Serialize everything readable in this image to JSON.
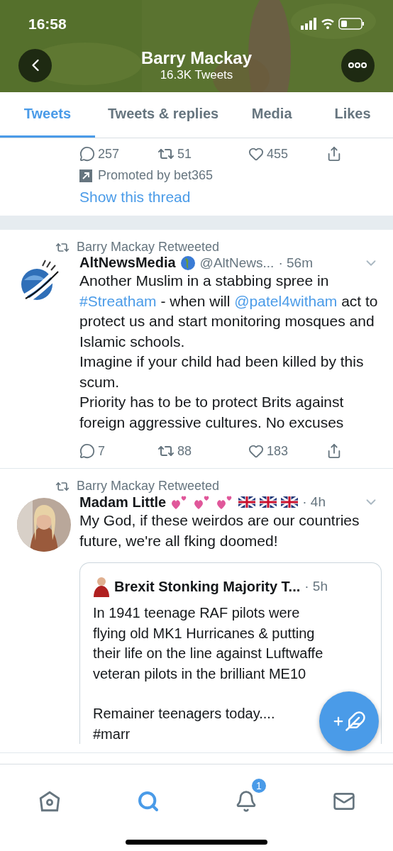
{
  "status_bar": {
    "time": "16:58"
  },
  "profile_header": {
    "name": "Barry Mackay",
    "tweet_count": "16.3K Tweets"
  },
  "tabs": [
    {
      "label": "Tweets",
      "selected": true
    },
    {
      "label": "Tweets & replies",
      "selected": false
    },
    {
      "label": "Media",
      "selected": false
    },
    {
      "label": "Likes",
      "selected": false
    }
  ],
  "partial_tweet": {
    "stats": {
      "replies": "257",
      "retweets": "51",
      "likes": "455"
    },
    "promoted": "Promoted by bet365",
    "thread_link": "Show this thread"
  },
  "tweets": [
    {
      "kind": "logo",
      "retweeted_by": "Barry Mackay Retweeted",
      "name": "AltNewsMedia",
      "name_icons": [
        {
          "kind": "globe"
        }
      ],
      "handle": "@AltNews...",
      "time": "· 56m",
      "paragraphs": [
        [
          {
            "kind": "text",
            "text": "Another Muslim in a stabbing spree in"
          },
          {
            "kind": "link",
            "text": "#Streatham"
          },
          {
            "kind": "text",
            "text": "- when will"
          },
          {
            "kind": "link",
            "text": "@patel4witham"
          },
          {
            "kind": "text",
            "text": "act to protect us and start monitoring mosques and Islamic schools."
          }
        ],
        [
          {
            "kind": "text",
            "text": "Imagine if your child had been killed by this scum."
          }
        ],
        [
          {
            "kind": "text",
            "text": "Priority has to be to protect Brits against foreign aggressive cultures. No excuses"
          }
        ]
      ],
      "stats": {
        "replies": "7",
        "retweets": "88",
        "likes": "183"
      }
    },
    {
      "kind": "picture",
      "retweeted_by": "Barry Mackay Retweeted",
      "name": "Madam Little",
      "name_icons": [
        {
          "kind": "hearts"
        },
        {
          "kind": "hearts"
        },
        {
          "kind": "hearts"
        },
        {
          "kind": "flag"
        },
        {
          "kind": "flag"
        },
        {
          "kind": "flag"
        }
      ],
      "time": "· 4h",
      "paragraphs": [
        [
          {
            "kind": "text",
            "text": "My God, if these weirdos are our countries future, we're all fking doomed!"
          }
        ]
      ],
      "quote": {
        "name": "Brexit Stonking Majority T...",
        "time": "· 5h",
        "paragraphs": [
          [
            "In 1941 teenage RAF pilots were",
            "flying old MK1 Hurricanes & putting",
            "their life on the line against Luftwaffe",
            "veteran pilots in the brilliant ME10"
          ],
          [
            "Remainer teenagers today....",
            "#marr"
          ]
        ]
      }
    }
  ],
  "bottom_nav": [
    {
      "kind": "home",
      "selected": false
    },
    {
      "kind": "search",
      "selected": true
    },
    {
      "kind": "notifications",
      "selected": false,
      "badge": "1"
    },
    {
      "kind": "messages",
      "selected": false
    }
  ]
}
